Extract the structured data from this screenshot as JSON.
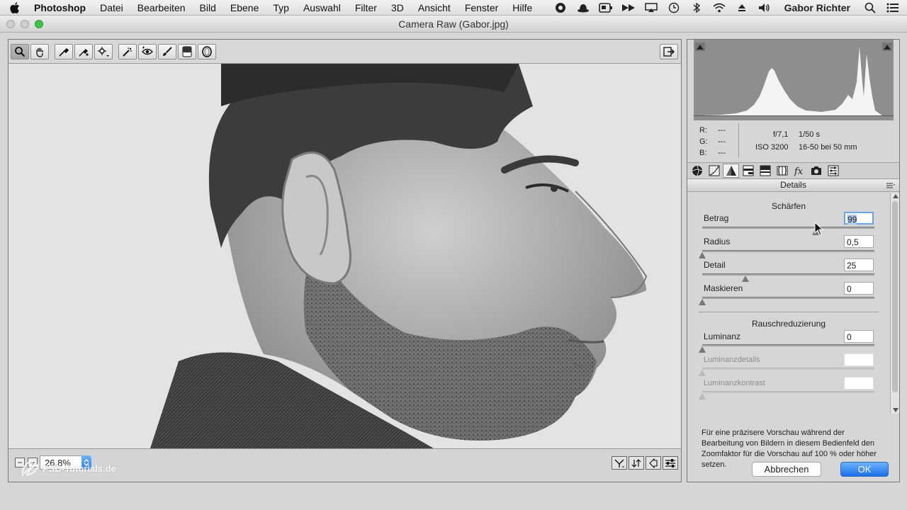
{
  "menubar": {
    "app_name": "Photoshop",
    "items": [
      "Datei",
      "Bearbeiten",
      "Bild",
      "Ebene",
      "Typ",
      "Auswahl",
      "Filter",
      "3D",
      "Ansicht",
      "Fenster",
      "Hilfe"
    ],
    "user": "Gabor Richter",
    "status_icons": [
      "creative-cloud-icon",
      "hat-icon",
      "card-icon",
      "arrows-icon",
      "airplay-icon",
      "time-machine-icon",
      "bluetooth-icon",
      "wifi-icon",
      "eject-icon",
      "volume-icon"
    ]
  },
  "window": {
    "title": "Camera Raw (Gabor.jpg)"
  },
  "toolbar": {
    "tools": [
      "zoom-tool",
      "hand-tool",
      "white-balance-tool",
      "color-sampler-tool",
      "targeted-adjustment-tool",
      "spot-removal-tool",
      "red-eye-tool",
      "adjustment-brush-tool",
      "graduated-filter-tool",
      "radial-filter-tool"
    ],
    "active_tool": "zoom-tool"
  },
  "bottombar": {
    "zoom_value": "26,8%"
  },
  "readout": {
    "r_label": "R:",
    "g_label": "G:",
    "b_label": "B:",
    "r_value": "---",
    "g_value": "---",
    "b_value": "---",
    "aperture": "f/7,1",
    "shutter": "1/50 s",
    "iso": "ISO 3200",
    "lens": "16-50 bei 50 mm"
  },
  "panel": {
    "title": "Details",
    "sharpen": {
      "title": "Schärfen",
      "controls": [
        {
          "label": "Betrag",
          "value": "99",
          "max": 150,
          "level": 99
        },
        {
          "label": "Radius",
          "value": "0,5",
          "max": 3,
          "level": 0.5,
          "min": 0.5
        },
        {
          "label": "Detail",
          "value": "25",
          "max": 100,
          "level": 25
        },
        {
          "label": "Maskieren",
          "value": "0",
          "max": 100,
          "level": 0
        }
      ]
    },
    "noise": {
      "title": "Rauschreduzierung",
      "controls": [
        {
          "label": "Luminanz",
          "value": "0"
        },
        {
          "label": "Luminanzdetails",
          "value": ""
        },
        {
          "label": "Luminanzkontrast",
          "value": ""
        }
      ]
    },
    "hint": "Für eine präzisere Vorschau während der Bearbeitung von Bildern in diesem Bedienfeld den Zoomfaktor für die Vorschau auf 100 % oder höher setzen."
  },
  "buttons": {
    "cancel": "Abbrechen",
    "ok": "OK"
  },
  "watermark": "PSD-Tutorials.de",
  "colors": {
    "accent": "#2f7fe8",
    "histogram_bg": "#8e8e8e"
  }
}
